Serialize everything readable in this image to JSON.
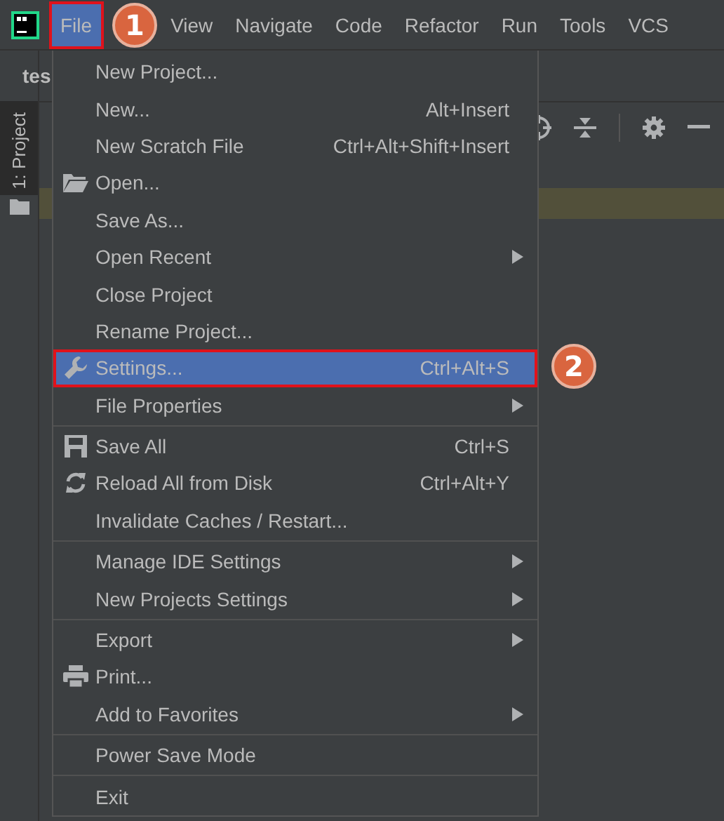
{
  "menubar": [
    {
      "label": "File",
      "selected": true,
      "callout": "1"
    },
    {
      "label": "View",
      "selected": false
    },
    {
      "label": "Navigate",
      "selected": false
    },
    {
      "label": "Code",
      "selected": false
    },
    {
      "label": "Refactor",
      "selected": false
    },
    {
      "label": "Run",
      "selected": false
    },
    {
      "label": "Tools",
      "selected": false
    },
    {
      "label": "VCS",
      "selected": false
    }
  ],
  "editor_tab": {
    "label": "tes"
  },
  "tool_window": {
    "label": "1: Project"
  },
  "menu": {
    "groups": [
      [
        {
          "label": "New Project...",
          "submenu": false,
          "selected": false
        },
        {
          "label": "New...",
          "shortcut": "Alt+Insert",
          "submenu": false,
          "selected": false
        },
        {
          "label": "New Scratch File",
          "shortcut": "Ctrl+Alt+Shift+Insert",
          "submenu": false,
          "selected": false
        },
        {
          "label": "Open...",
          "submenu": false,
          "selected": false
        },
        {
          "label": "Save As...",
          "submenu": false,
          "selected": false
        },
        {
          "label": "Open Recent",
          "submenu": true,
          "selected": false
        },
        {
          "label": "Close Project",
          "submenu": false,
          "selected": false
        },
        {
          "label": "Rename Project...",
          "submenu": false,
          "selected": false
        },
        {
          "label": "Settings...",
          "shortcut": "Ctrl+Alt+S",
          "submenu": false,
          "selected": true,
          "callout": "2"
        },
        {
          "label": "File Properties",
          "submenu": true,
          "selected": false
        }
      ],
      [
        {
          "label": "Save All",
          "shortcut": "Ctrl+S",
          "submenu": false,
          "selected": false
        },
        {
          "label": "Reload All from Disk",
          "shortcut": "Ctrl+Alt+Y",
          "submenu": false,
          "selected": false
        },
        {
          "label": "Invalidate Caches / Restart...",
          "submenu": false,
          "selected": false
        }
      ],
      [
        {
          "label": "Manage IDE Settings",
          "submenu": true,
          "selected": false
        },
        {
          "label": "New Projects Settings",
          "submenu": true,
          "selected": false
        }
      ],
      [
        {
          "label": "Export",
          "submenu": true,
          "selected": false
        },
        {
          "label": "Print...",
          "submenu": false,
          "selected": false
        },
        {
          "label": "Add to Favorites",
          "submenu": true,
          "selected": false
        }
      ],
      [
        {
          "label": "Power Save Mode",
          "submenu": false,
          "selected": false
        }
      ],
      [
        {
          "label": "Exit",
          "submenu": false,
          "selected": false
        }
      ]
    ]
  }
}
